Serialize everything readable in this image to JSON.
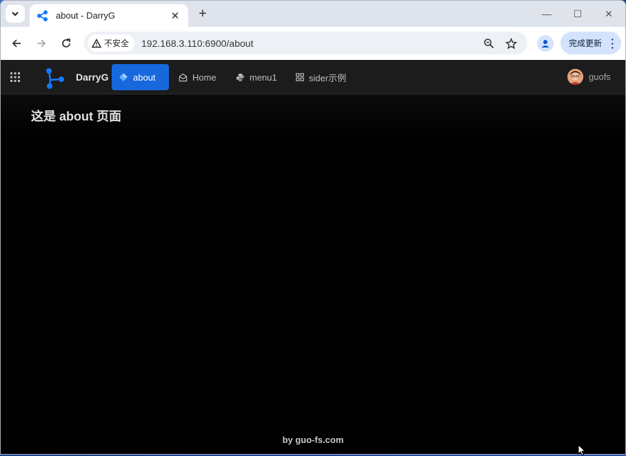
{
  "browser": {
    "tab_title": "about - DarryG",
    "security_label": "不安全",
    "url": "192.168.3.110:6900/about",
    "update_button": "完成更新"
  },
  "app": {
    "brand": "DarryG",
    "menu": [
      {
        "label": "about",
        "icon": "diamond-icon",
        "active": true
      },
      {
        "label": "Home",
        "icon": "mail-icon",
        "active": false
      },
      {
        "label": "menu1",
        "icon": "python-icon",
        "active": false
      },
      {
        "label": "sider示例",
        "icon": "grid-icon",
        "active": false
      }
    ],
    "user_name": "guofs",
    "accent_color": "#1668dc"
  },
  "main": {
    "title": "这是 about 页面"
  },
  "footer": {
    "text": "by guo-fs.com"
  }
}
